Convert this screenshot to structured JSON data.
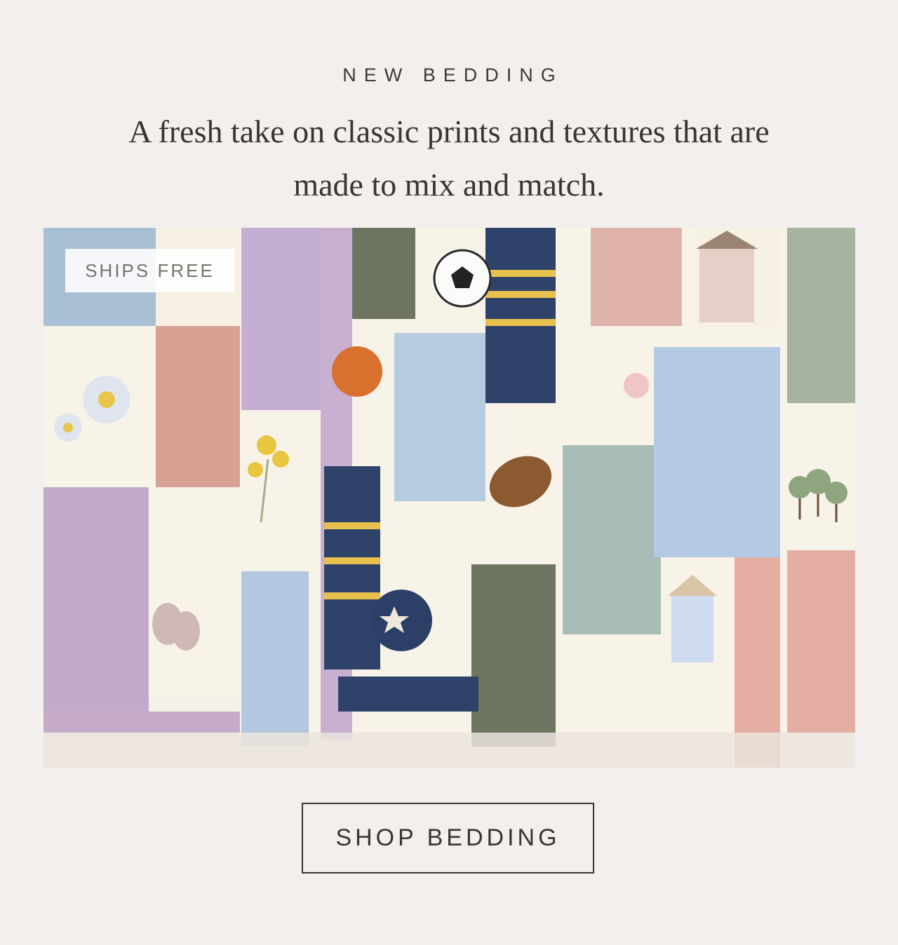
{
  "header": {
    "eyebrow": "NEW BEDDING",
    "headline": "A fresh take on classic prints and textures that are made to mix and match."
  },
  "hero": {
    "badge": "SHIPS FREE",
    "image_alt": "Knit patchwork baby blankets hanging in a row with embroidered flowers, sports balls, houses and trees"
  },
  "cta": {
    "label": "SHOP BEDDING"
  },
  "colors": {
    "background": "#f2efed",
    "text": "#3a3534",
    "badge_text": "#77716f"
  }
}
